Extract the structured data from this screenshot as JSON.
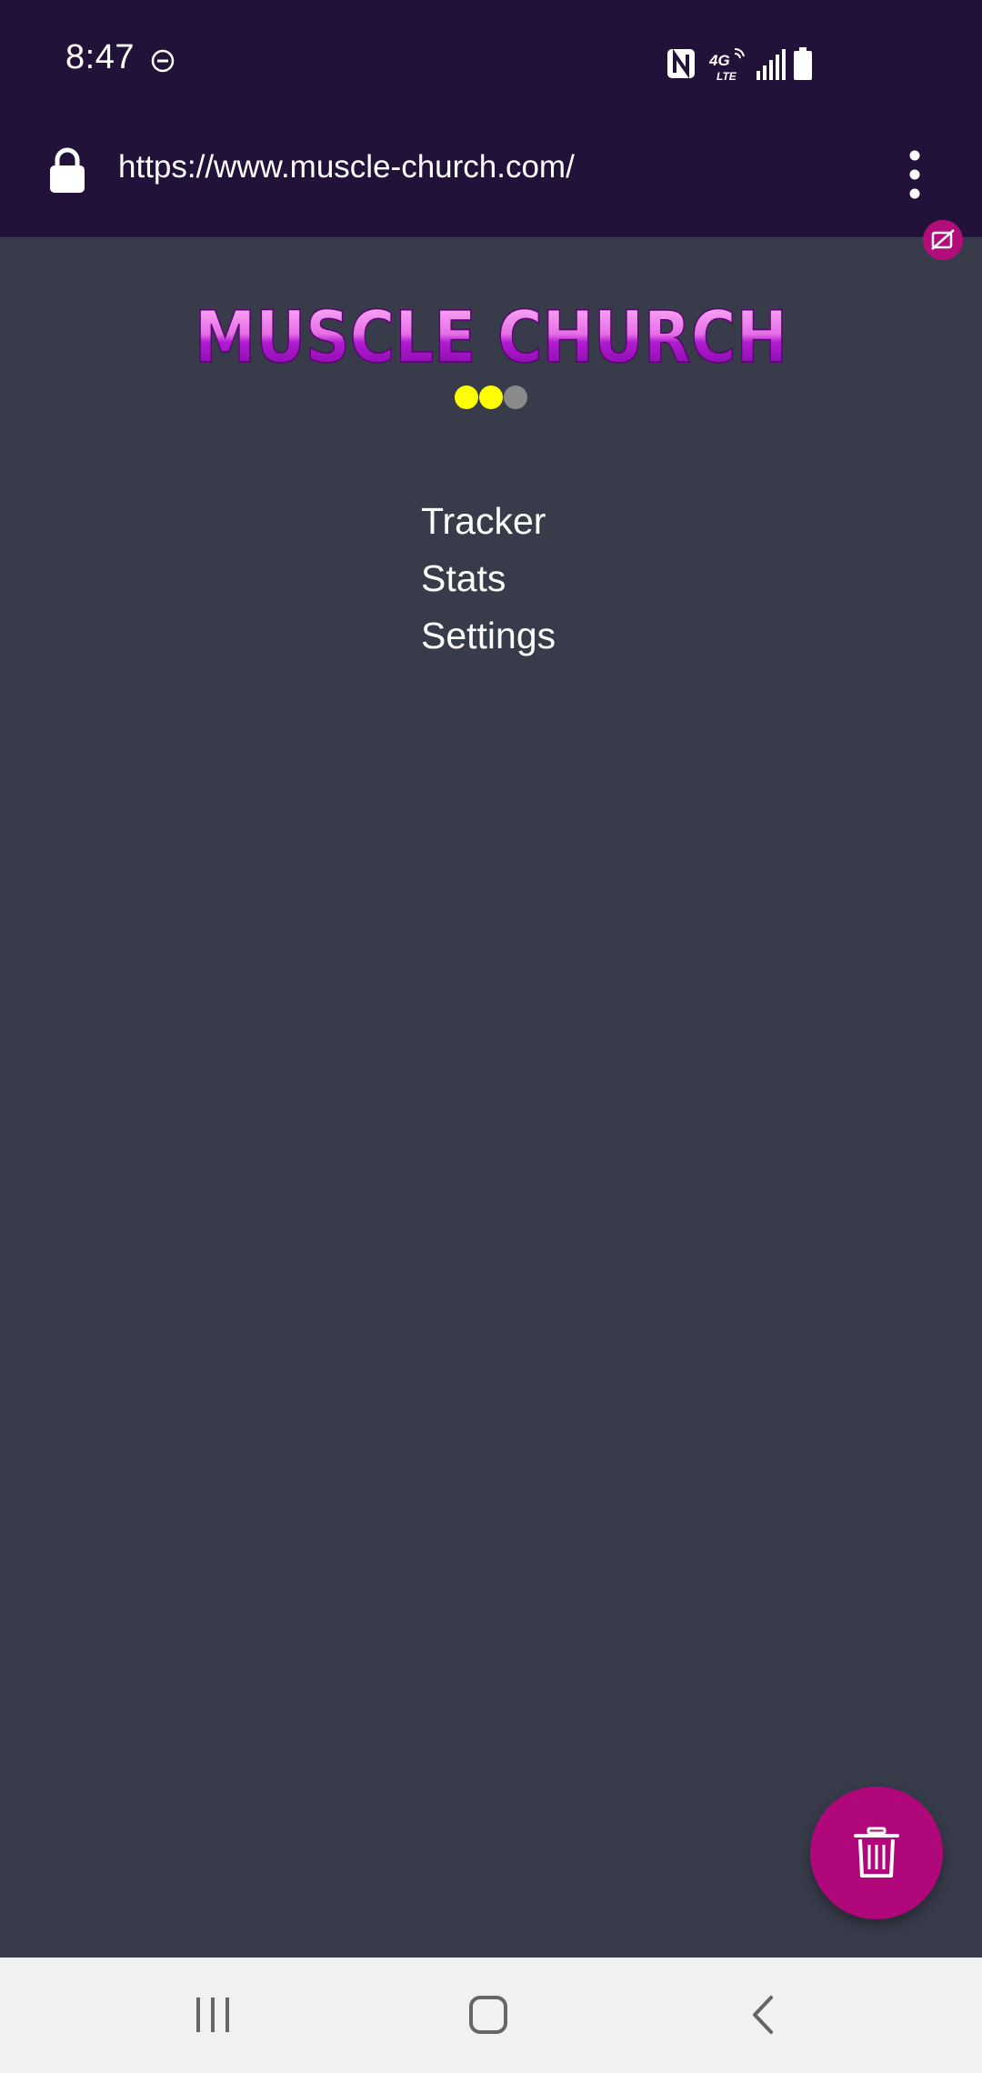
{
  "status_bar": {
    "time": "8:47",
    "icons": [
      "do-not-disturb-icon",
      "nfc-icon",
      "4g-lte-icon",
      "signal-icon",
      "battery-icon"
    ]
  },
  "browser": {
    "url": "https://www.muscle-church.com/",
    "lock_icon": "lock-icon",
    "menu_icon": "more-vert-icon",
    "privacy_icon": "tracking-blocked-icon"
  },
  "app": {
    "logo_text": "MUSCLE CHURCH",
    "progress_dots": {
      "filled": 2,
      "total": 3,
      "active_color": "#ffff00",
      "inactive_color": "#8a8a8a"
    },
    "nav_items": [
      {
        "label": "Tracker"
      },
      {
        "label": "Stats"
      },
      {
        "label": "Settings"
      }
    ],
    "fab_icon": "trash-icon"
  },
  "theme": {
    "background": "#383b4a",
    "header": "#22123a",
    "accent": "#b0087b",
    "logo_top": "#f2a0f0",
    "logo_bottom": "#8a08b8"
  },
  "system_nav": {
    "icons": [
      "recents-icon",
      "home-icon",
      "back-icon"
    ]
  }
}
